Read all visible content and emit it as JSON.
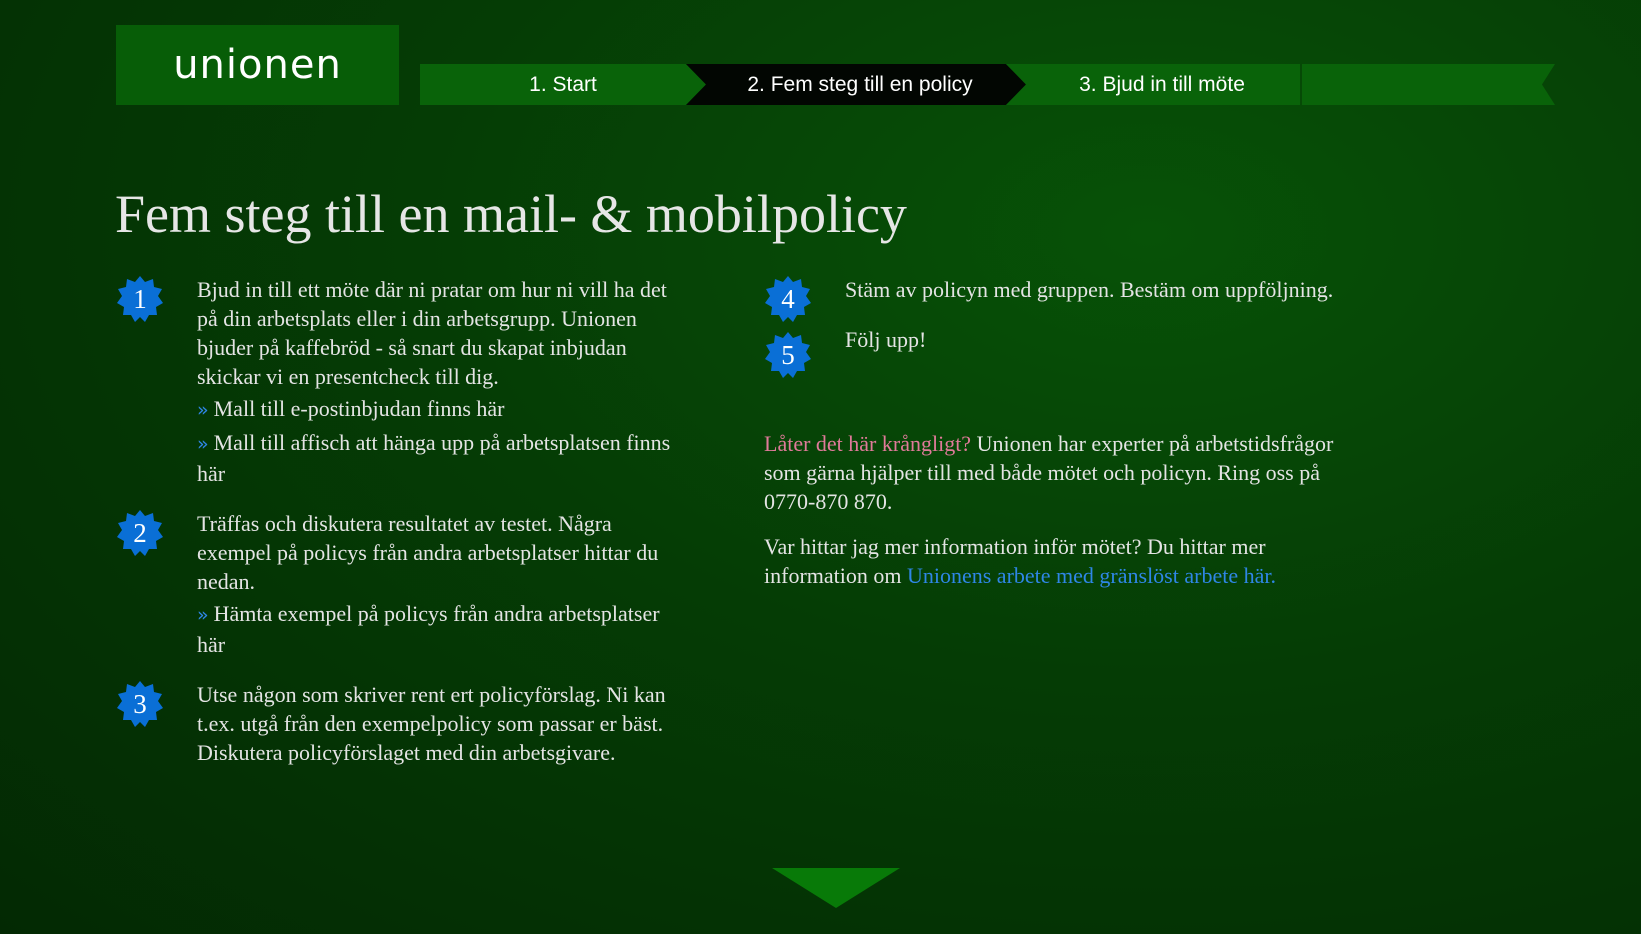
{
  "logo": {
    "text": "unionen"
  },
  "nav": {
    "steps": [
      {
        "label": "1. Start"
      },
      {
        "label": "2. Fem steg till en policy"
      },
      {
        "label": "3. Bjud in till möte"
      },
      {
        "label": ""
      }
    ]
  },
  "page": {
    "title": "Fem steg till en mail- & mobilpolicy"
  },
  "steps": [
    {
      "number": "1",
      "text": "Bjud in till ett möte där ni pratar om hur ni vill ha det på din arbetsplats eller i din arbetsgrupp. Unionen bjuder på kaffebröd - så snart du skapat inbjudan skickar vi en presentcheck till dig.",
      "links": [
        "Mall till e-postinbjudan finns här",
        "Mall till affisch att hänga upp på arbetsplatsen finns här"
      ]
    },
    {
      "number": "2",
      "text": "Träffas och diskutera resultatet av testet. Några exempel på policys från andra arbetsplatser hittar du nedan.",
      "links": [
        "Hämta exempel på policys från andra arbetsplatser här"
      ]
    },
    {
      "number": "3",
      "text": "Utse någon som skriver rent ert policyförslag. Ni kan t.ex. utgå från den exempelpolicy som passar er bäst. Diskutera policyförslaget med din arbetsgivare.",
      "links": []
    },
    {
      "number": "4",
      "text": "Stäm av policyn med gruppen. Bestäm om uppföljning.",
      "links": []
    },
    {
      "number": "5",
      "text": "Följ upp!",
      "links": []
    }
  ],
  "help": {
    "highlight": "Låter det här krångligt?",
    "text": " Unionen har experter på arbetstidsfrågor som gärna hjälper till med både mötet och policyn. Ring oss på 0770-870 870.",
    "info_text": "Var hittar jag mer information inför mötet? Du hittar mer information om ",
    "info_link": "Unionens arbete med gränslöst arbete här."
  },
  "chevron_glyph": "»",
  "colors": {
    "badge": "#0a6fd6",
    "accent_pink": "#e07a9a",
    "link_blue": "#2f86e6",
    "nav_green": "#096309",
    "nav_active": "#020602"
  }
}
